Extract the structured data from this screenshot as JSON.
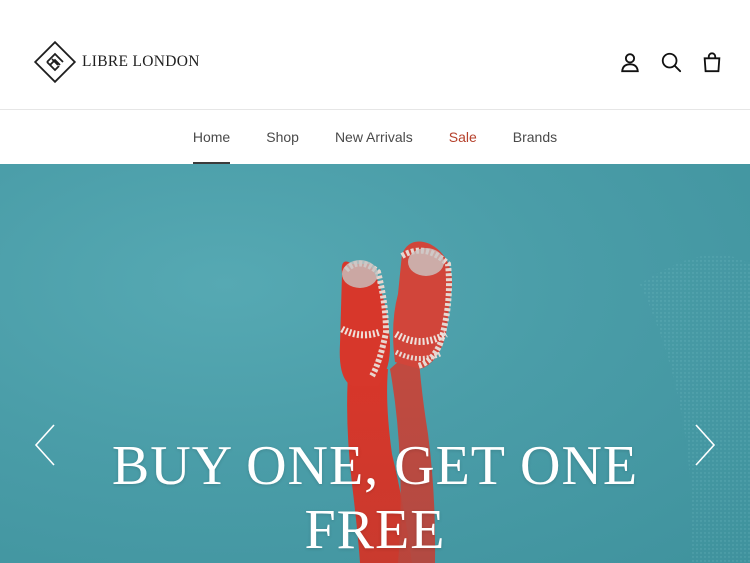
{
  "brand": {
    "name": "LIBRE LONDON"
  },
  "header": {
    "icons": [
      "account-icon",
      "search-icon",
      "cart-icon"
    ]
  },
  "nav": {
    "items": [
      {
        "label": "Home",
        "active": true
      },
      {
        "label": "Shop"
      },
      {
        "label": "New Arrivals"
      },
      {
        "label": "Sale",
        "color": "#b5402b"
      },
      {
        "label": "Brands"
      }
    ]
  },
  "hero": {
    "headline_line1": "BUY ONE, GET ONE",
    "headline_line2": "FREE",
    "background_color": "#4a9da8",
    "icons": [
      "chevron-left-icon",
      "chevron-right-icon"
    ]
  },
  "colors": {
    "sale": "#b5402b",
    "text": "#4a4a4a",
    "hero_teal": "#4a9da8"
  }
}
